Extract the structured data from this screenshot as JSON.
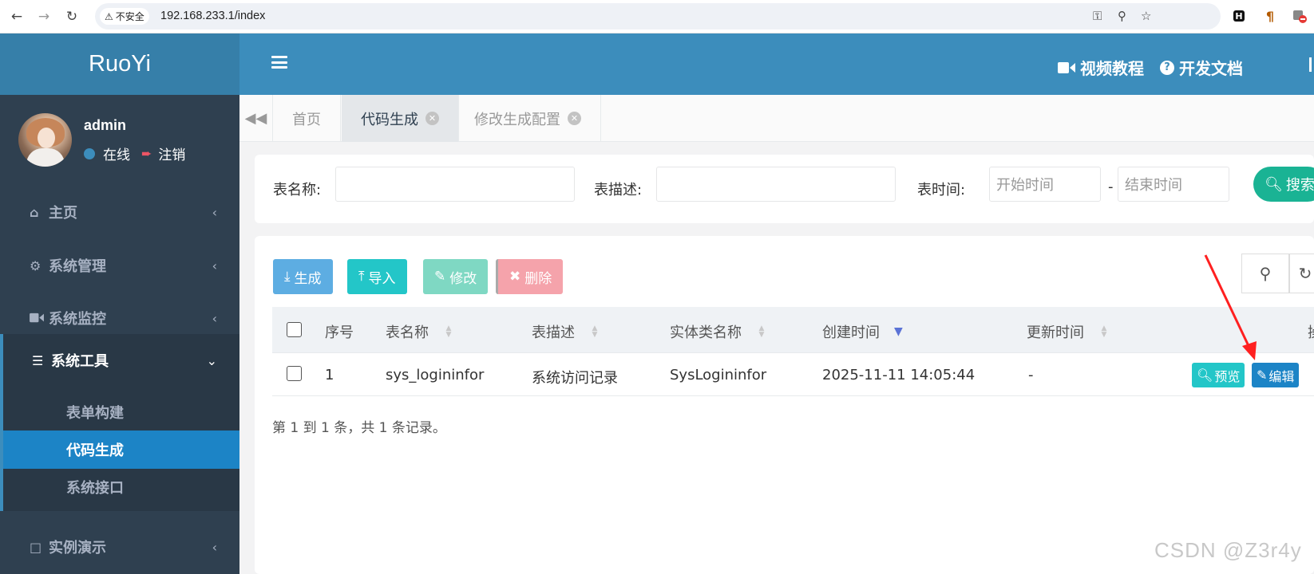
{
  "browser": {
    "insecure_label": "不安全",
    "url": "192.168.233.1/index"
  },
  "header": {
    "logo": "RuoYi",
    "video_tutorial": "视频教程",
    "dev_docs": "开发文档"
  },
  "user": {
    "name": "admin",
    "status": "在线",
    "logout": "注销"
  },
  "sidebar": {
    "items": [
      {
        "label": "主页",
        "icon": "home-icon"
      },
      {
        "label": "系统管理",
        "icon": "gear-icon"
      },
      {
        "label": "系统监控",
        "icon": "video-camera-icon"
      },
      {
        "label": "系统工具",
        "icon": "bars-icon"
      },
      {
        "label": "实例演示",
        "icon": "desktop-icon"
      }
    ],
    "tools_submenu": [
      "表单构建",
      "代码生成",
      "系统接口"
    ]
  },
  "tabs": [
    {
      "label": "首页"
    },
    {
      "label": "代码生成"
    },
    {
      "label": "修改生成配置"
    }
  ],
  "search": {
    "table_name_label": "表名称:",
    "table_desc_label": "表描述:",
    "table_time_label": "表时间:",
    "start_placeholder": "开始时间",
    "end_placeholder": "结束时间",
    "separator": "-",
    "search_button": "搜索"
  },
  "toolbar": {
    "generate": "生成",
    "import": "导入",
    "edit": "修改",
    "delete": "删除"
  },
  "table": {
    "columns": [
      "序号",
      "表名称",
      "表描述",
      "实体类名称",
      "创建时间",
      "更新时间",
      "操"
    ],
    "rows": [
      {
        "index": "1",
        "table_name": "sys_logininfor",
        "table_desc": "系统访问记录",
        "class_name": "SysLogininfor",
        "create_time": "2025-11-11 14:05:44",
        "update_time": "-",
        "preview": "预览",
        "edit": "编辑"
      }
    ],
    "page_info": "第 1 到 1 条，共 1 条记录。"
  },
  "watermark": "CSDN @Z3r4y",
  "colors": {
    "header": "#3c8dbc",
    "sidebar": "#2f4050",
    "active_sub": "#1c84c6",
    "success": "#1ab394",
    "info": "#23c6c8",
    "danger": "#ed5565",
    "annotation_arrow": "#ff2020"
  }
}
